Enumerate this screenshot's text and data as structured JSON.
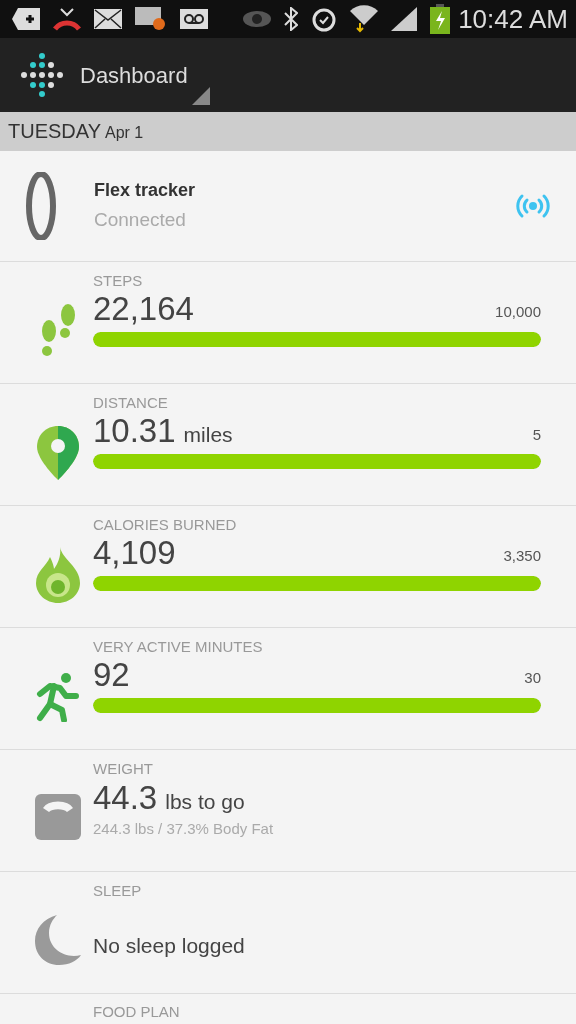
{
  "status_bar": {
    "time": "10:42 AM",
    "battery_charging": true
  },
  "action_bar": {
    "title": "Dashboard"
  },
  "date_header": {
    "day": "TUESDAY",
    "date": "Apr 1"
  },
  "tracker": {
    "name": "Flex tracker",
    "status": "Connected",
    "connected": true
  },
  "tiles": [
    {
      "kind": "progress",
      "label": "STEPS",
      "value": "22,164",
      "goal": "10,000",
      "level": 1
    },
    {
      "kind": "progress",
      "label": "DISTANCE",
      "value": "10.31",
      "unit": "miles",
      "goal": "5",
      "level": 1
    },
    {
      "kind": "progress",
      "label": "CALORIES BURNED",
      "value": "4,109",
      "goal": "3,350",
      "level": 1
    },
    {
      "kind": "progress",
      "label": "VERY ACTIVE MINUTES",
      "value": "92",
      "goal": "30",
      "level": 1
    },
    {
      "kind": "weight",
      "label": "WEIGHT",
      "value": "44.3",
      "unit": "lbs to go",
      "detail": "244.3 lbs / 37.3% Body Fat"
    },
    {
      "kind": "message",
      "label": "SLEEP",
      "message": "No sleep logged"
    },
    {
      "kind": "header",
      "label": "FOOD PLAN"
    }
  ]
}
